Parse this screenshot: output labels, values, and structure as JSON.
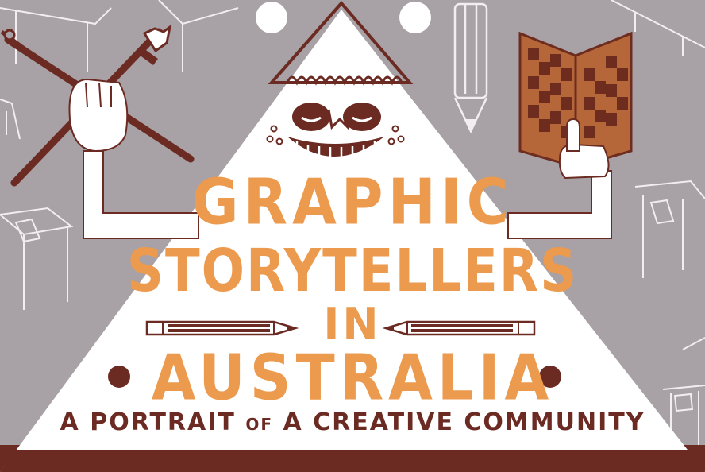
{
  "title": {
    "line1": "GRAPHIC",
    "line2": "STORYTELLERS",
    "line3": "IN",
    "line4": "AUSTRALIA"
  },
  "subtitle": {
    "part1": "A PORTRAIT",
    "part2": "OF",
    "part3": "A CREATIVE COMMUNITY"
  },
  "colors": {
    "background": "#a8a1a5",
    "triangle": "#ffffff",
    "title_orange": "#ec9a4d",
    "brown": "#6b2a22",
    "book_light": "#b5673a",
    "book_dark": "#6e2c1f"
  },
  "icons": [
    "paintbrush-icon",
    "pencil-icon",
    "book-icon",
    "desk-icon"
  ]
}
